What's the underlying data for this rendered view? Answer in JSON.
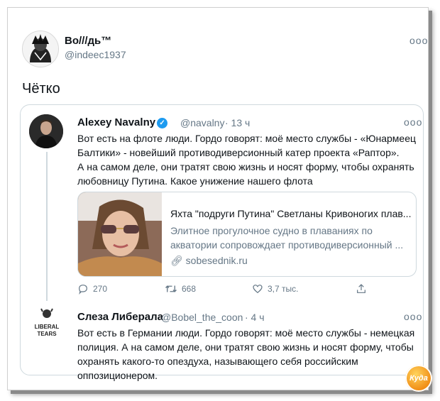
{
  "tweet": {
    "author_name": "Bo///дь™",
    "author_handle": "@indeec1937",
    "menu": "ooo",
    "text": "Чётко"
  },
  "quoted": {
    "author_name": "Alexey Navalny",
    "author_handle": "@navalny",
    "time": "· 13 ч",
    "menu": "ooo",
    "text_lines": [
      "Вот есть на флоте люди. Гордо говорят: моё место службы - «Юнармеец",
      "Балтики» - новейший противодиверсионный катер проекта «Раптор».",
      "А на самом деле, они тратят свою жизнь и носят форму, чтобы охранять",
      "любовницу Путина. Какое унижение нашего флота"
    ],
    "card": {
      "title": "Яхта \"подруги Путина\" Светланы Кривоногих плав...",
      "description_lines": [
        "Элитное прогулочное судно в плаваниях по",
        "акватории сопровождает противодиверсионный ..."
      ],
      "link": "sobesednik.ru"
    },
    "actions": {
      "replies": "270",
      "retweets": "668",
      "likes": "3,7 тыс."
    }
  },
  "reply": {
    "author_name": "Слеза Либерала",
    "author_handle": "@Bobel_the_coon",
    "time": "· 4 ч",
    "menu": "ooo",
    "avatar_text": [
      "LIBERAL",
      "TEARS"
    ],
    "text_lines": [
      "Вот есть в Германии люди. Гордо говорят: моё место службы - немецкая",
      "полиция. А на самом деле, они тратят свою жизнь и носят форму, чтобы",
      "охранять какого-то опездуха, называющего себя российским",
      "оппозиционером."
    ]
  },
  "watermark": "Куда",
  "colors": {
    "link_gray": "#657786",
    "verified_blue": "#1d9bf0",
    "border": "#cfd9de"
  }
}
